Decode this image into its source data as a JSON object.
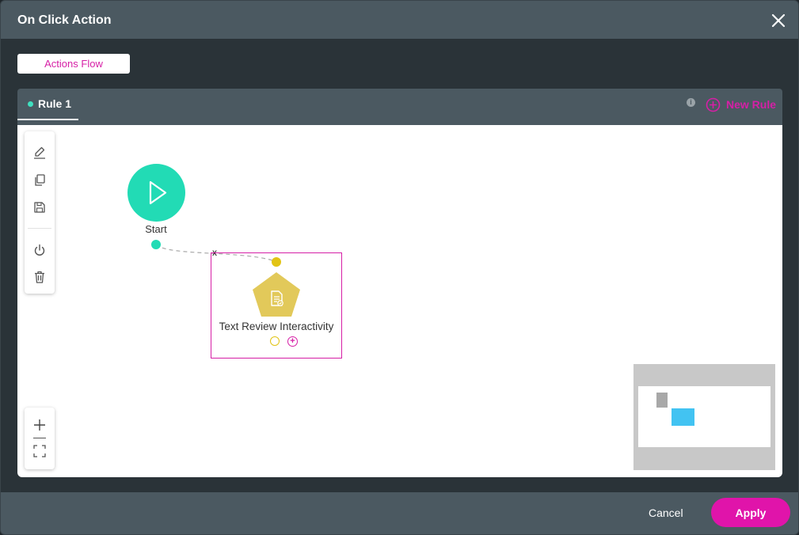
{
  "dialog": {
    "title": "On Click Action",
    "close_icon": "close-icon"
  },
  "flow_tab": {
    "label": "Actions Flow"
  },
  "rules": {
    "tabs": [
      {
        "label": "Rule 1",
        "active": true
      }
    ],
    "info_icon": "info-icon",
    "new_rule_label": "New Rule"
  },
  "toolbar": {
    "icons": [
      "edit-icon",
      "copy-icon",
      "save-icon",
      "power-icon",
      "trash-icon"
    ],
    "zoom_icons": [
      "zoom-in-icon",
      "fit-screen-icon"
    ]
  },
  "flow": {
    "start_node": {
      "label": "Start"
    },
    "action_node": {
      "label": "Text Review Interactivity",
      "icon": "document-check-icon",
      "selected": true
    },
    "remove_link_label": "x"
  },
  "footer": {
    "cancel_label": "Cancel",
    "apply_label": "Apply"
  },
  "colors": {
    "accent": "#e014aa",
    "start_node": "#22dbb5",
    "action_node": "#e2c414",
    "minimap_node": "#42c3f2",
    "header": "#4b5961",
    "background": "#2a3338"
  }
}
